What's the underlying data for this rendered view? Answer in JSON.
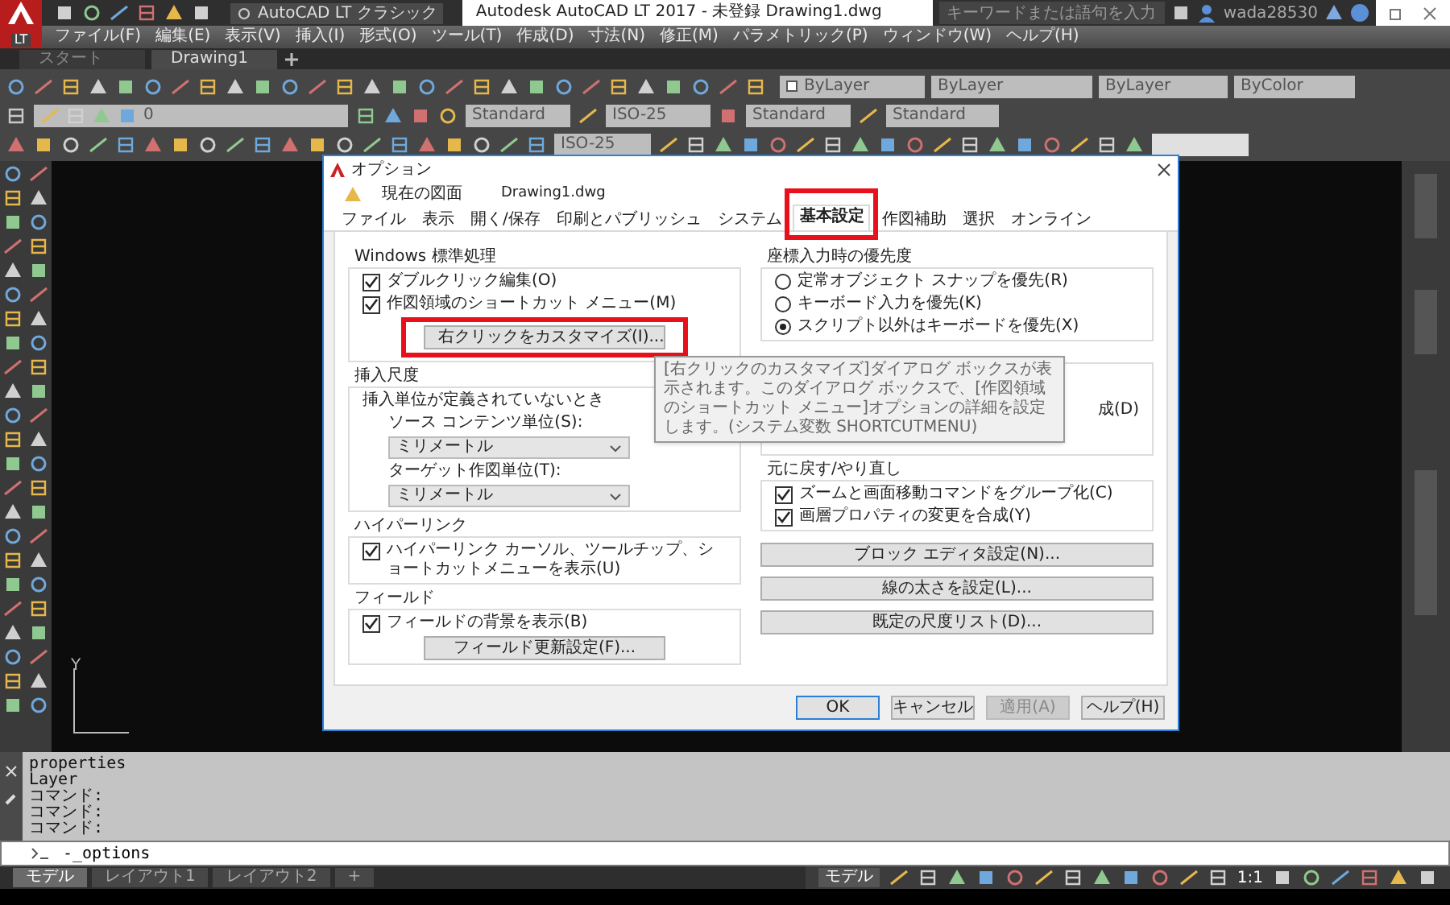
{
  "app_bar": {
    "edition": "LT",
    "workspace": "AutoCAD LT クラシック",
    "title": "Autodesk AutoCAD LT 2017 - 未登録    Drawing1.dwg",
    "search": {
      "placeholder": "キーワードまたは語句を入力"
    },
    "user": "wada28530"
  },
  "menu": [
    "ファイル(F)",
    "編集(E)",
    "表示(V)",
    "挿入(I)",
    "形式(O)",
    "ツール(T)",
    "作成(D)",
    "寸法(N)",
    "修正(M)",
    "パラメトリック(P)",
    "ウィンドウ(W)",
    "ヘルプ(H)"
  ],
  "doc_tabs": [
    {
      "label": "スタート",
      "selected": false
    },
    {
      "label": "Drawing1",
      "selected": true
    }
  ],
  "toolbars": {
    "color_control": "ByLayer",
    "linetype": "ByLayer",
    "lineweight": "ByLayer",
    "plotstyle": "ByColor",
    "layer": "0",
    "text_style": "Standard",
    "dim_style": "ISO-25",
    "table_style": "Standard",
    "multileader_style": "Standard",
    "dim_style_2": "ISO-25"
  },
  "dialog": {
    "title": "オプション",
    "drawing_label": "現在の図面",
    "drawing_name": "Drawing1.dwg",
    "tabs": [
      {
        "label": "ファイル",
        "selected": false,
        "highlighted": false
      },
      {
        "label": "表示",
        "selected": false,
        "highlighted": false
      },
      {
        "label": "開く/保存",
        "selected": false,
        "highlighted": false
      },
      {
        "label": "印刷とパブリッシュ",
        "selected": false,
        "highlighted": false
      },
      {
        "label": "システム",
        "selected": false,
        "highlighted": false
      },
      {
        "label": "基本設定",
        "selected": true,
        "highlighted": true
      },
      {
        "label": "作図補助",
        "selected": false,
        "highlighted": false
      },
      {
        "label": "選択",
        "selected": false,
        "highlighted": false
      },
      {
        "label": "オンライン",
        "selected": false,
        "highlighted": false
      }
    ],
    "windows_group": {
      "title": "Windows 標準処理",
      "checks": [
        {
          "label": "ダブルクリック編集(O)",
          "checked": true
        },
        {
          "label": "作図領域のショートカット メニュー(M)",
          "checked": true
        }
      ],
      "button": {
        "label": "右クリックをカスタマイズ(I)...",
        "highlighted": true
      }
    },
    "scale_group": {
      "title": "挿入尺度",
      "note": "挿入単位が定義されていないとき",
      "source_label": "ソース コンテンツ単位(S):",
      "source_value": "ミリメートル",
      "target_label": "ターゲット作図単位(T):",
      "target_value": "ミリメートル"
    },
    "hyperlink_group": {
      "title": "ハイパーリンク",
      "check": {
        "label": "ハイパーリンク カーソル、ツールチップ、ショートカットメニューを表示(U)",
        "checked": true
      }
    },
    "field_group": {
      "title": "フィールド",
      "check": {
        "label": "フィールドの背景を表示(B)",
        "checked": true
      },
      "button": "フィールド更新設定(F)..."
    },
    "priority_group": {
      "title": "座標入力時の優先度",
      "radios": [
        {
          "label": "定常オブジェクト スナップを優先(R)",
          "selected": false
        },
        {
          "label": "キーボード入力を優先(K)",
          "selected": false
        },
        {
          "label": "スクリプト以外はキーボードを優先(X)",
          "selected": true
        }
      ]
    },
    "hidden_group_text": "成(D)",
    "undo_group": {
      "title": "元に戻す/やり直し",
      "checks": [
        {
          "label": "ズームと画面移動コマンドをグループ化(C)",
          "checked": true
        },
        {
          "label": "画層プロパティの変更を合成(Y)",
          "checked": true
        }
      ]
    },
    "right_buttons": [
      "ブロック エディタ設定(N)...",
      "線の太さを設定(L)...",
      "既定の尺度リスト(D)..."
    ],
    "footer": [
      {
        "label": "OK",
        "disabled": false
      },
      {
        "label": "キャンセル",
        "disabled": false
      },
      {
        "label": "適用(A)",
        "disabled": true
      },
      {
        "label": "ヘルプ(H)",
        "disabled": false
      }
    ],
    "tooltip": "[右クリックのカスタマイズ]ダイアログ ボックスが表示されます。このダイアログ ボックスで、[作図領域のショートカット メニュー]オプションの詳細を設定します。(システム変数 SHORTCUTMENU)"
  },
  "ucs": {
    "axis": "Y"
  },
  "command_history": [
    "properties",
    "Layer",
    "コマンド:",
    "コマンド:",
    "コマンド:"
  ],
  "command_input": "-_options",
  "layout_tabs": [
    {
      "label": "モデル",
      "selected": true
    },
    {
      "label": "レイアウト1",
      "selected": false
    },
    {
      "label": "レイアウト2",
      "selected": false
    },
    {
      "label": "+",
      "selected": false
    }
  ],
  "status": {
    "model": "モデル",
    "scale": "1:1"
  }
}
